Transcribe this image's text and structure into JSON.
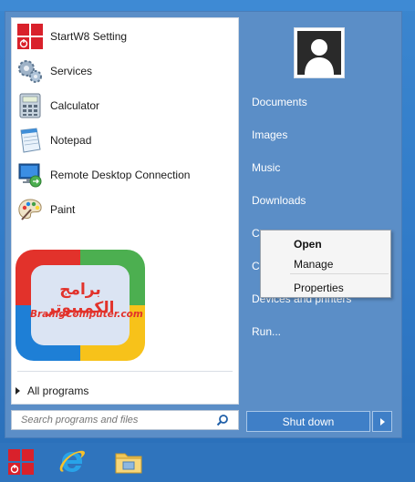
{
  "start_menu": {
    "programs": [
      {
        "label": "StartW8 Setting",
        "icon": "startw8-power-icon"
      },
      {
        "label": "Services",
        "icon": "gears-icon"
      },
      {
        "label": "Calculator",
        "icon": "calculator-icon"
      },
      {
        "label": "Notepad",
        "icon": "notepad-icon"
      },
      {
        "label": "Remote Desktop Connection",
        "icon": "remote-desktop-icon"
      },
      {
        "label": "Paint",
        "icon": "paint-palette-icon"
      }
    ],
    "logo": {
      "line1": "برامج الكمبيوتر",
      "line2": "BramgComputer.com"
    },
    "all_programs": "All programs",
    "search_placeholder": "Search programs and files",
    "right_items": [
      "Documents",
      "Images",
      "Music",
      "Downloads",
      "C",
      "C",
      "Devices and printers",
      "Run..."
    ],
    "shutdown_label": "Shut down"
  },
  "context_menu": {
    "items": [
      "Open",
      "Manage",
      "Properties"
    ]
  },
  "taskbar": {
    "items": [
      "startw8-button-icon",
      "internet-explorer-icon",
      "file-explorer-icon"
    ]
  },
  "colors": {
    "menu_bg": "#5b8ec7",
    "accent_red": "#d9212b",
    "taskbar": "#2f74bd"
  }
}
